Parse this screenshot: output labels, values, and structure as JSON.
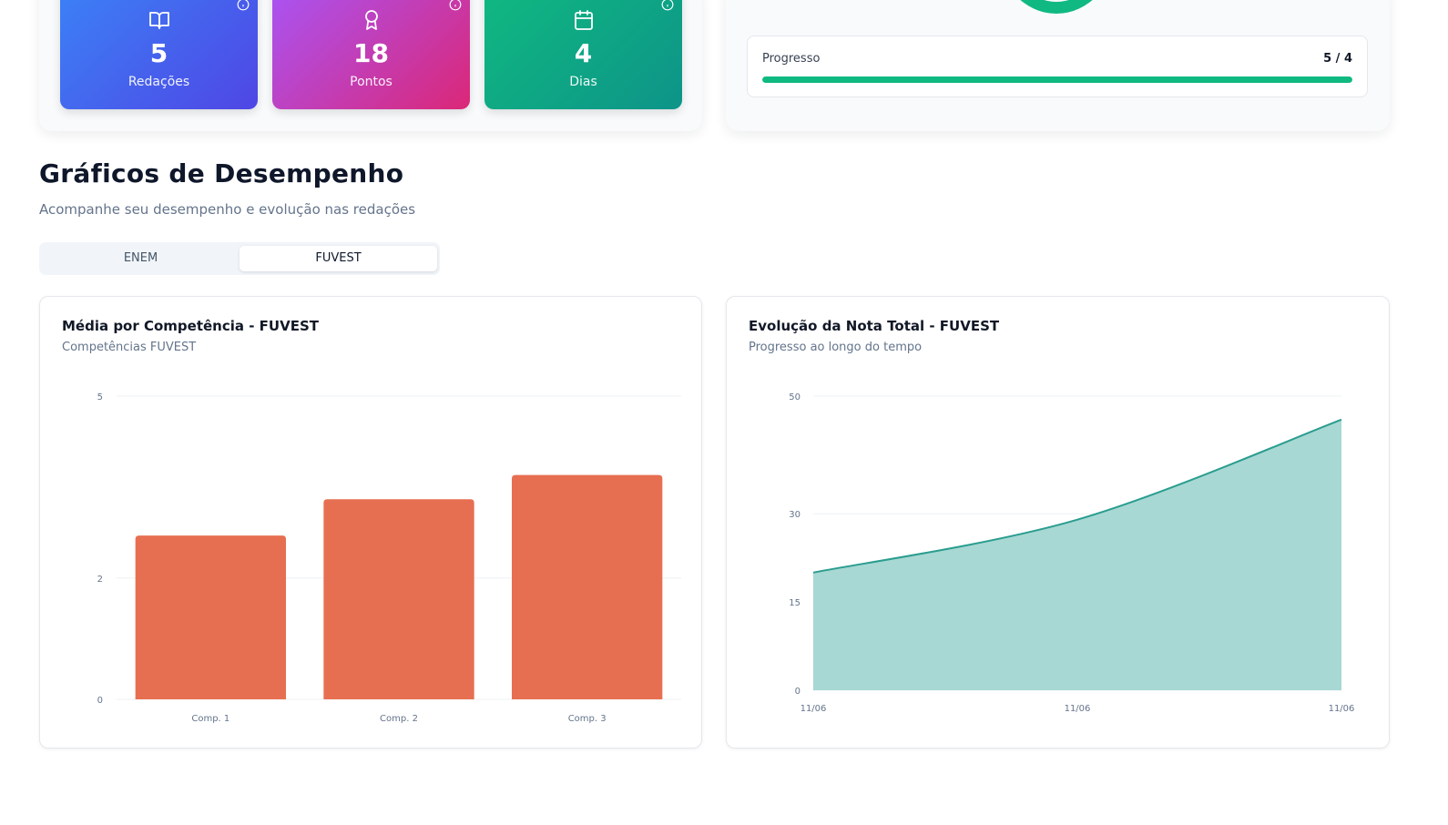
{
  "stats": [
    {
      "value": "5",
      "label": "Redações",
      "icon": "book-open-icon",
      "color": "#3b82f6"
    },
    {
      "value": "18",
      "label": "Pontos",
      "icon": "award-icon",
      "color": "#d946ef"
    },
    {
      "value": "4",
      "label": "Dias",
      "icon": "calendar-icon",
      "color": "#10b981"
    }
  ],
  "progress": {
    "label": "Progresso",
    "count": "5 / 4",
    "fraction": 1.0
  },
  "section": {
    "title": "Gráficos de Desempenho",
    "subtitle": "Acompanhe seu desempenho e evolução nas redações"
  },
  "tabs": [
    {
      "label": "ENEM",
      "active": false
    },
    {
      "label": "FUVEST",
      "active": true
    }
  ],
  "chart_data": [
    {
      "type": "bar",
      "title": "Média por Competência - FUVEST",
      "subtitle": "Competências FUVEST",
      "categories": [
        "Comp. 1",
        "Comp. 2",
        "Comp. 3"
      ],
      "values": [
        2.7,
        3.3,
        3.7
      ],
      "yticks": [
        0,
        2,
        5
      ],
      "ylim": [
        0,
        5
      ],
      "color": "#e76f51",
      "grid": true
    },
    {
      "type": "area",
      "title": "Evolução da Nota Total - FUVEST",
      "subtitle": "Progresso ao longo do tempo",
      "x": [
        "11/06",
        "11/06",
        "11/06"
      ],
      "values": [
        20,
        29,
        46
      ],
      "yticks": [
        0,
        15,
        30,
        50
      ],
      "ylim": [
        0,
        50
      ],
      "color": "#2a9d8f",
      "fill": "#a8d8d3",
      "grid": true
    }
  ]
}
